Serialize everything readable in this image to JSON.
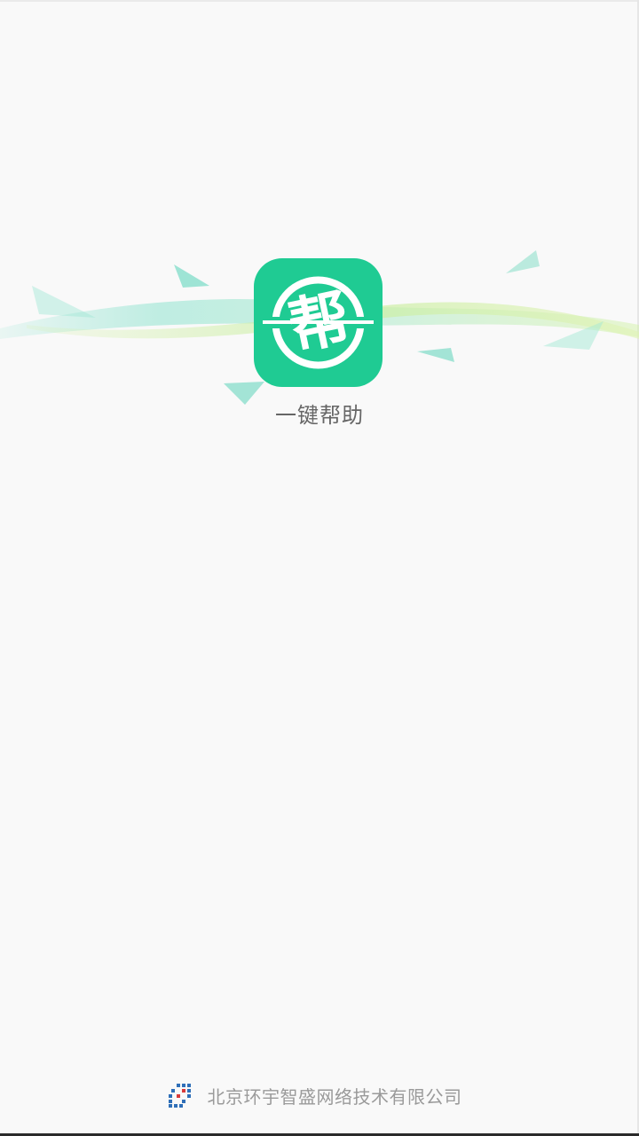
{
  "app": {
    "name": "一键帮助",
    "icon_glyph": "帮",
    "icon_name": "bang-help-app-icon",
    "accent_color": "#1fcb93"
  },
  "footer": {
    "company": "北京环宇智盛网络技术有限公司",
    "logo_icon": "company-logo-icon"
  },
  "colors": {
    "background": "#f9f9f9",
    "ribbon_teal": "#7fdcc8",
    "ribbon_lime": "#c6eea0",
    "app_name_text": "#666666",
    "footer_text": "#9a9a9a"
  }
}
